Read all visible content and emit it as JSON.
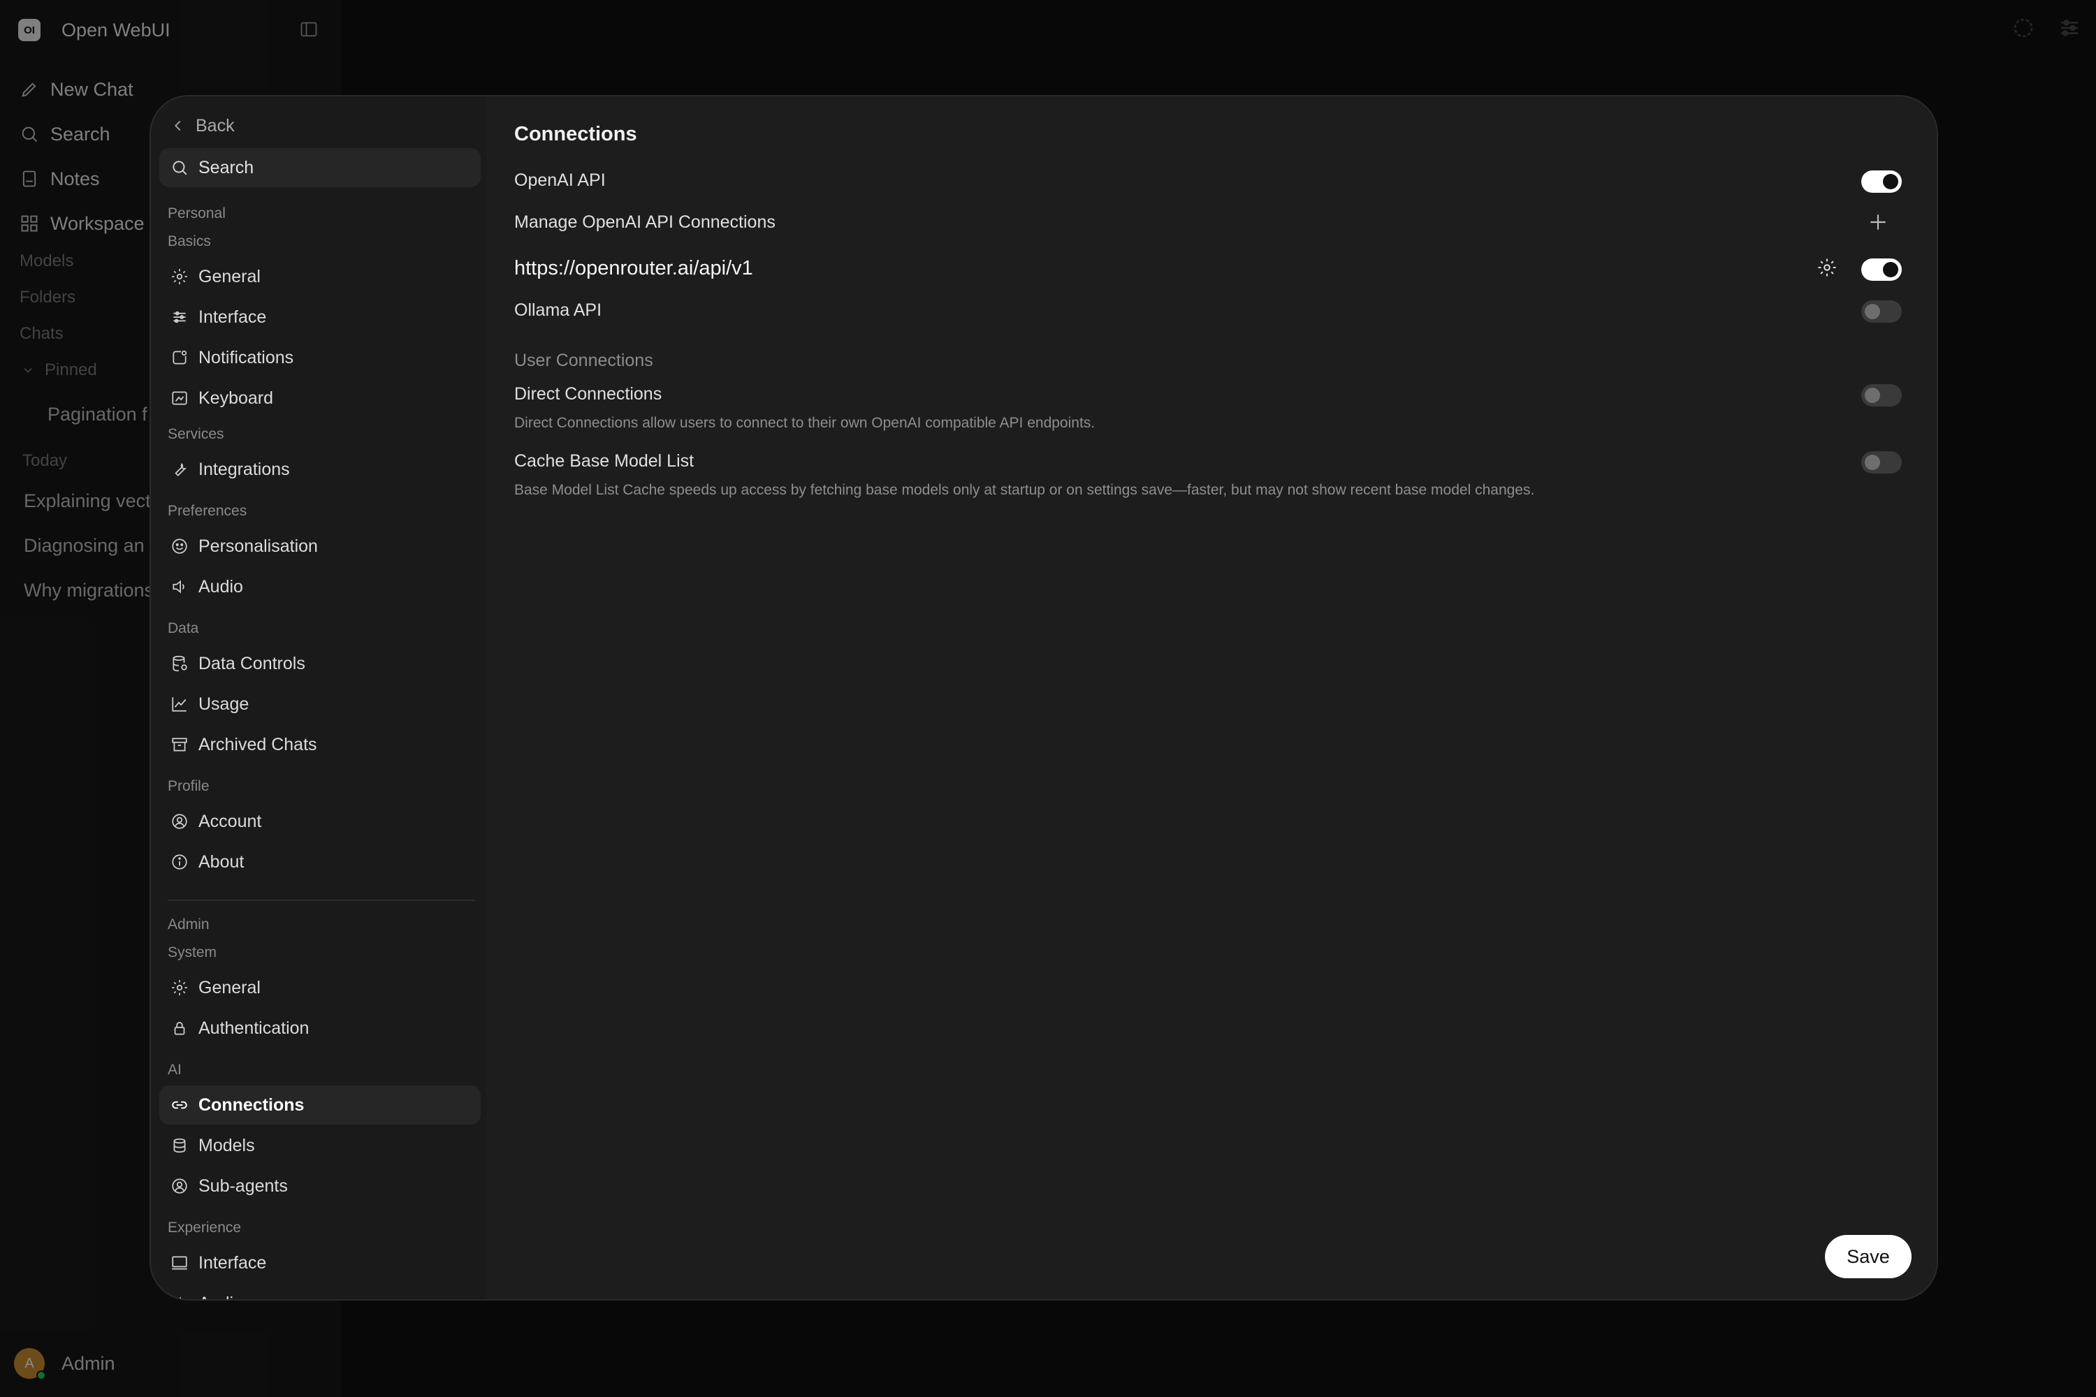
{
  "app": {
    "brand_logo": "OI",
    "title": "Open WebUI",
    "nav": [
      {
        "label": "New Chat",
        "icon": "pencil-icon"
      },
      {
        "label": "Search",
        "icon": "search-icon"
      },
      {
        "label": "Notes",
        "icon": "notes-icon"
      },
      {
        "label": "Workspace",
        "icon": "workspace-icon"
      }
    ],
    "sections": {
      "models": "Models",
      "folders": "Folders",
      "chats": "Chats",
      "pinned": "Pinned",
      "today": "Today"
    },
    "pinned_chat": "Pagination f",
    "today_chats": [
      "Explaining vect",
      "Diagnosing an",
      "Why migrations"
    ],
    "user": {
      "name": "Admin",
      "initial": "A"
    }
  },
  "modal": {
    "back_label": "Back",
    "search_placeholder": "Search",
    "groups": {
      "personal": "Personal",
      "basics": "Basics",
      "services": "Services",
      "preferences": "Preferences",
      "data": "Data",
      "profile": "Profile",
      "admin": "Admin",
      "system": "System",
      "ai": "AI",
      "experience": "Experience"
    },
    "items": {
      "general": "General",
      "interface": "Interface",
      "notifications": "Notifications",
      "keyboard": "Keyboard",
      "integrations": "Integrations",
      "personalisation": "Personalisation",
      "audio": "Audio",
      "data_controls": "Data Controls",
      "usage": "Usage",
      "archived_chats": "Archived Chats",
      "account": "Account",
      "about": "About",
      "admin_general": "General",
      "authentication": "Authentication",
      "connections": "Connections",
      "models": "Models",
      "sub_agents": "Sub-agents",
      "exp_interface": "Interface",
      "exp_audio": "Audio"
    },
    "active_item": "Connections"
  },
  "settings": {
    "title": "Connections",
    "openai_api": {
      "label": "OpenAI API",
      "enabled": true
    },
    "manage_openai": "Manage OpenAI API Connections",
    "openai_connection": {
      "url": "https://openrouter.ai/api/v1",
      "enabled": true
    },
    "ollama_api": {
      "label": "Ollama API",
      "enabled": false
    },
    "user_connections_label": "User Connections",
    "direct_connections": {
      "label": "Direct Connections",
      "description": "Direct Connections allow users to connect to their own OpenAI compatible API endpoints.",
      "enabled": false
    },
    "cache_base_model_list": {
      "label": "Cache Base Model List",
      "description": "Base Model List Cache speeds up access by fetching base models only at startup or on settings save—faster, but may not show recent base model changes.",
      "enabled": false
    },
    "save_label": "Save"
  }
}
